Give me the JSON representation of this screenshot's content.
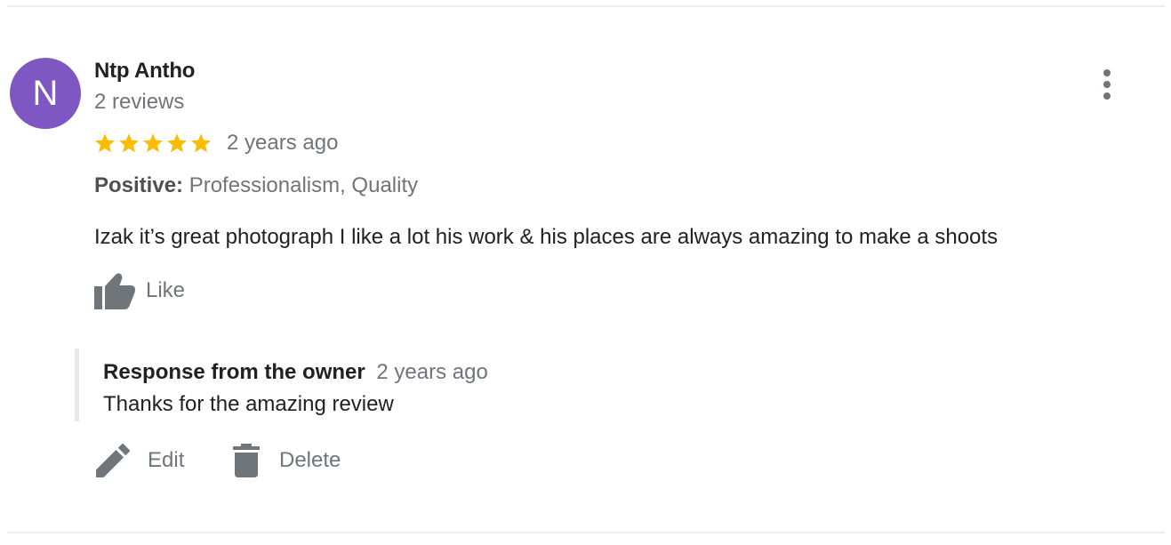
{
  "review": {
    "avatar_letter": "N",
    "avatar_color": "#7e57c2",
    "reviewer_name": "Ntp Antho",
    "review_count": "2 reviews",
    "rating": 5,
    "rating_max": 5,
    "star_color": "#fbbc04",
    "time_ago": "2 years ago",
    "positive_label": "Positive:",
    "positive_values": "Professionalism, Quality",
    "text": "Izak it’s great photograph I like a lot his work & his places are always amazing to make a shoots",
    "like_label": "Like",
    "more_icon": "more-vert-icon"
  },
  "owner_response": {
    "title": "Response from the owner",
    "time_ago": "2 years ago",
    "text": "Thanks for the amazing review"
  },
  "actions": {
    "edit_label": "Edit",
    "delete_label": "Delete",
    "edit_icon": "pencil-icon",
    "delete_icon": "trash-icon"
  },
  "colors": {
    "secondary_text": "#70757a",
    "primary_text": "#202124",
    "icon_gray": "#70757a"
  }
}
